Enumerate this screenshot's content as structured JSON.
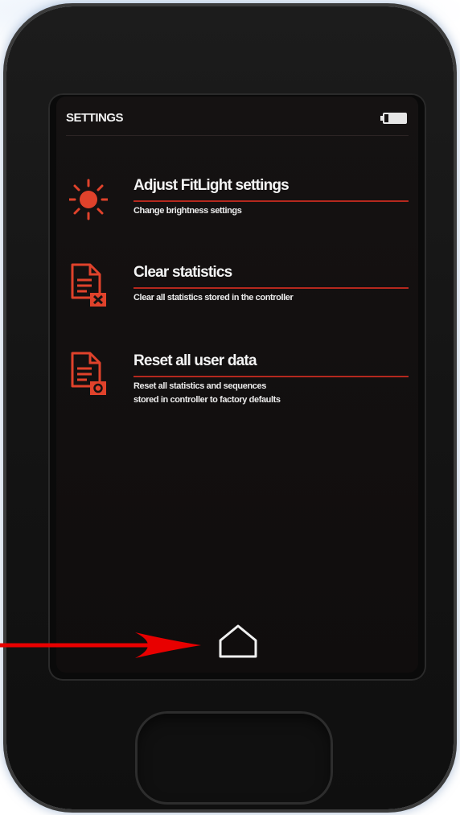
{
  "screen": {
    "title": "SETTINGS",
    "battery_icon": "battery-icon",
    "items": [
      {
        "icon": "sun-icon",
        "title": "Adjust FitLight settings",
        "subtitle_lines": [
          "Change brightness settings"
        ]
      },
      {
        "icon": "document-delete-icon",
        "title": "Clear statistics",
        "subtitle_lines": [
          "Clear all statistics stored in the controller"
        ]
      },
      {
        "icon": "document-reset-icon",
        "title": "Reset all user data",
        "subtitle_lines": [
          "Reset all statistics and sequences",
          "stored in controller to factory defaults"
        ]
      }
    ],
    "home_icon": "home-icon"
  },
  "annotation": {
    "arrow_icon": "red-arrow-icon"
  },
  "colors": {
    "accent": "#e0422b",
    "rule": "#b5281e",
    "screen_bg": "#141111",
    "text": "#f2f2f2",
    "device_glow": "#7ea3cc",
    "arrow": "#e80000"
  }
}
